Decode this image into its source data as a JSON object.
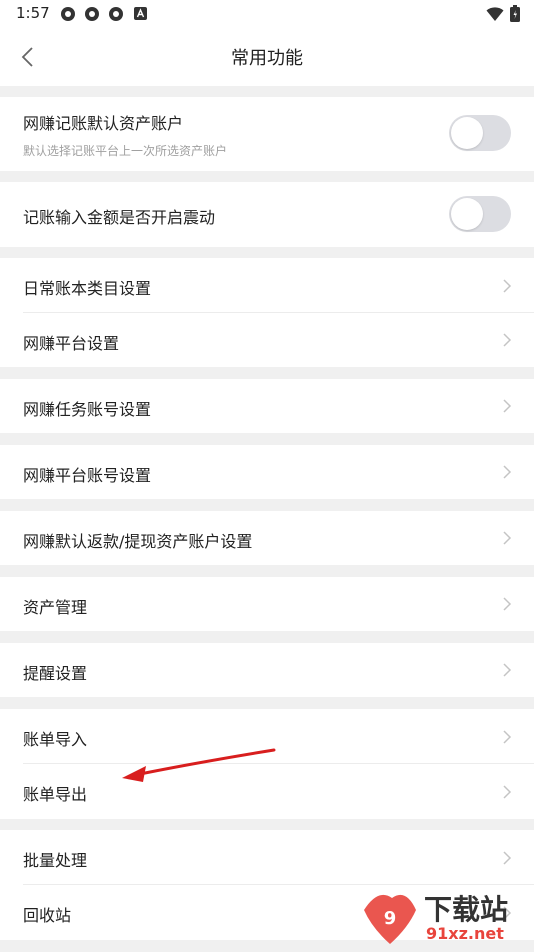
{
  "status_bar": {
    "time": "1:57",
    "left_icons": [
      "app-icon",
      "app-icon",
      "app-icon",
      "a-icon"
    ],
    "right_icons": [
      "wifi-icon",
      "battery-icon"
    ]
  },
  "nav": {
    "title": "常用功能",
    "back_icon": "chevron-left-icon"
  },
  "settings": {
    "default_account": {
      "label": "网赚记账默认资产账户",
      "desc": "默认选择记账平台上一次所选资产账户",
      "enabled": false
    },
    "vibration": {
      "label": "记账输入金额是否开启震动",
      "enabled": false
    },
    "items": {
      "daily_category": "日常账本类目设置",
      "platform_settings": "网赚平台设置",
      "task_account": "网赚任务账号设置",
      "platform_account": "网赚平台账号设置",
      "refund_account": "网赚默认返款/提现资产账户设置",
      "asset_mgmt": "资产管理",
      "reminder": "提醒设置",
      "import": "账单导入",
      "export": "账单导出",
      "batch": "批量处理",
      "recycle": "回收站"
    }
  },
  "watermark": {
    "text_main": "下载站",
    "text_sub": "91xz.net"
  },
  "colors": {
    "toggle_off": "#dcdde2",
    "annotation_arrow": "#d81e1e",
    "page_bg": "#f0f0f0"
  }
}
